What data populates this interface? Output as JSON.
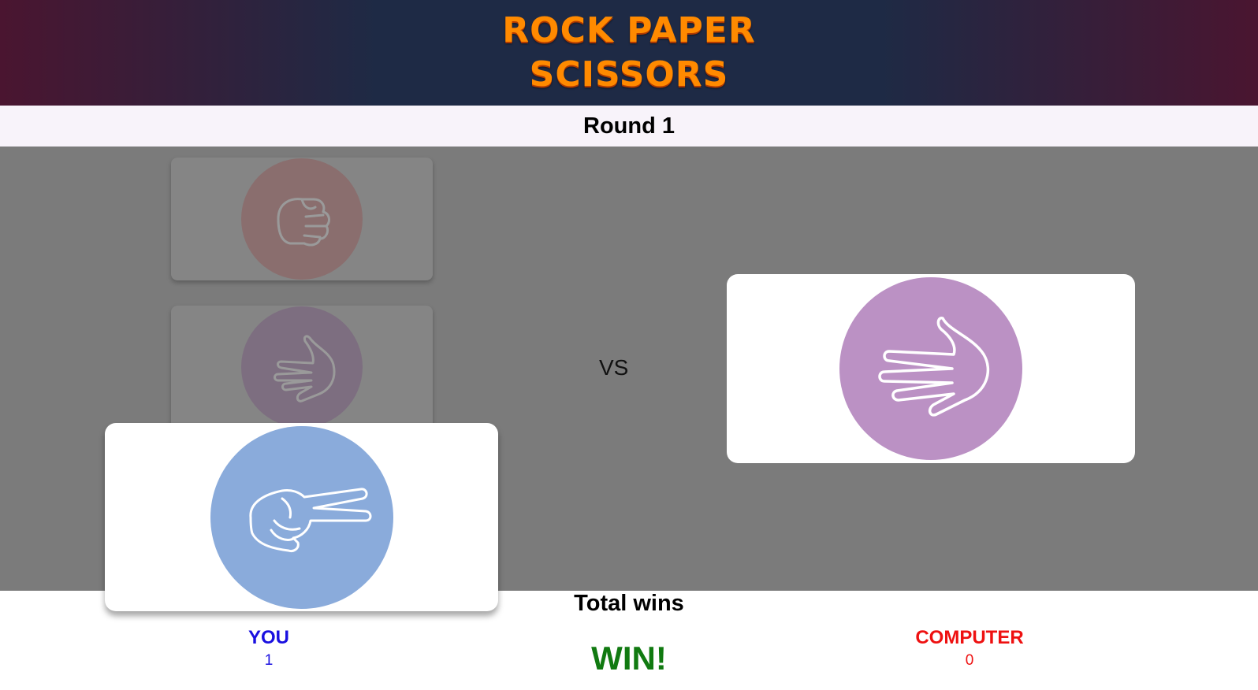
{
  "header": {
    "title_line1": "ROCK PAPER",
    "title_line2": "SCISSORS"
  },
  "round": {
    "label": "Round 1"
  },
  "choices": [
    {
      "name": "rock",
      "icon": "rock-fist-icon",
      "color": "#d27876"
    },
    {
      "name": "paper",
      "icon": "paper-hand-icon",
      "color": "#9a7ba3"
    }
  ],
  "arena": {
    "vs_label": "VS",
    "player_pick": {
      "icon": "scissors-hand-icon",
      "color": "#8aabdb"
    },
    "computer_pick": {
      "icon": "paper-hand-icon",
      "color": "#bb91c4"
    }
  },
  "totals": {
    "heading": "Total wins",
    "you_label": "YOU",
    "you_score": "1",
    "computer_label": "COMPUTER",
    "computer_score": "0",
    "result": "WIN!"
  },
  "colors": {
    "you": "#1a10e0",
    "computer": "#ee1111",
    "win": "#117a11"
  }
}
